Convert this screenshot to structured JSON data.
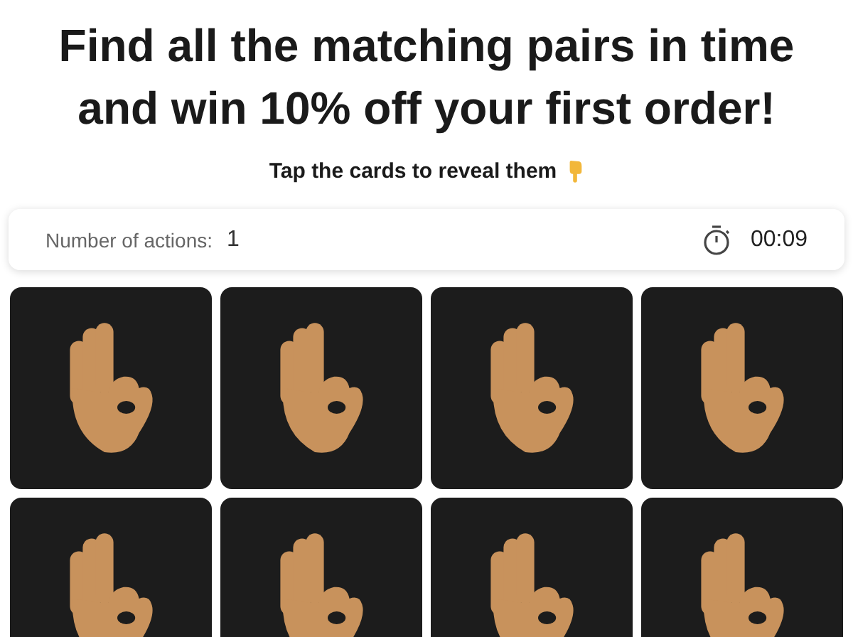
{
  "headline": [
    "Find all the matching pairs in time",
    "and win 10% off your first order!"
  ],
  "instruction": "Tap the cards to reveal them",
  "stats": {
    "actions_label": "Number of actions:",
    "actions_value": "1",
    "timer": "00:09"
  },
  "cards": [
    {
      "kind": "back"
    },
    {
      "kind": "back"
    },
    {
      "kind": "back"
    },
    {
      "kind": "back"
    },
    {
      "kind": "back"
    },
    {
      "kind": "back"
    },
    {
      "kind": "back"
    },
    {
      "kind": "back"
    }
  ]
}
